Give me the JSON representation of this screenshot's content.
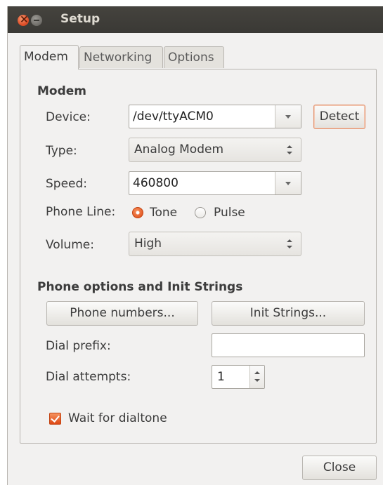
{
  "window": {
    "title": "Setup"
  },
  "tabs": [
    {
      "label": "Modem",
      "active": true
    },
    {
      "label": "Networking",
      "active": false
    },
    {
      "label": "Options",
      "active": false
    }
  ],
  "modem": {
    "heading": "Modem",
    "device_label": "Device:",
    "device_value": "/dev/ttyACM0",
    "detect_label": "Detect",
    "type_label": "Type:",
    "type_value": "Analog Modem",
    "speed_label": "Speed:",
    "speed_value": "460800",
    "phone_line_label": "Phone Line:",
    "tone_label": "Tone",
    "pulse_label": "Pulse",
    "phone_line_selected": "Tone",
    "volume_label": "Volume:",
    "volume_value": "High"
  },
  "phone_options": {
    "heading": "Phone options and Init Strings",
    "phone_numbers_label": "Phone numbers...",
    "init_strings_label": "Init Strings...",
    "dial_prefix_label": "Dial prefix:",
    "dial_prefix_value": "",
    "dial_attempts_label": "Dial attempts:",
    "dial_attempts_value": "1",
    "wait_dialtone_label": "Wait for dialtone",
    "wait_dialtone_checked": true
  },
  "footer": {
    "close_label": "Close"
  },
  "colors": {
    "accent": "#dd4814",
    "titlebar": "#3c3b37",
    "window_bg": "#f2f1f0"
  }
}
